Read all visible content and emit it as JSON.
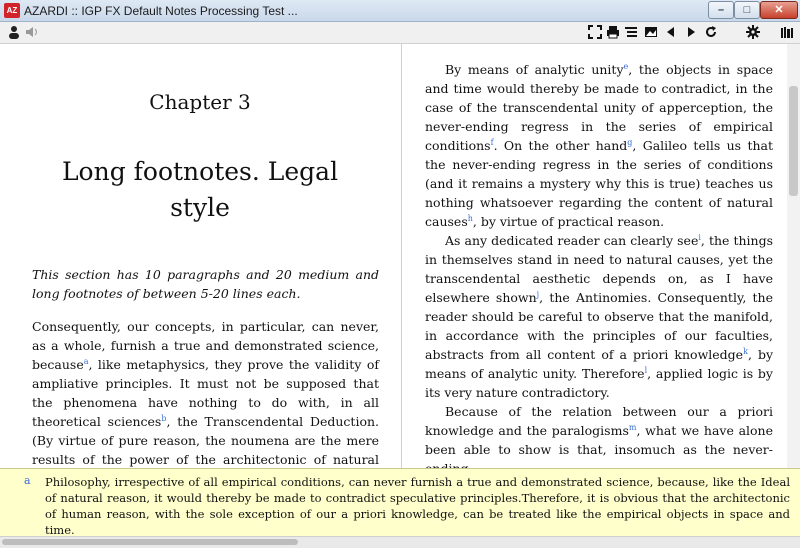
{
  "window": {
    "title": "AZARDI :: IGP FX Default Notes Processing Test ...",
    "app_icon_text": "AZ",
    "minimize": "–",
    "maximize": "□",
    "close": "✕"
  },
  "toolbar": {
    "icons_left": [
      "user-icon",
      "speaker-icon"
    ],
    "icons_right": [
      "fullscreen-icon",
      "print-icon",
      "toc-icon",
      "image-icon",
      "back-icon",
      "forward-icon",
      "refresh-icon",
      "settings-icon",
      "library-icon"
    ]
  },
  "left_page": {
    "chapter_number": "Chapter 3",
    "chapter_title": "Long footnotes. Legal style",
    "abstract": "This section has 10 paragraphs and 20 medium and long footnotes of between 5-20 lines each.",
    "paragraph": {
      "t1": "Consequently, our concepts, in particular, can never, as a whole, furnish a true and demonstrated science, because",
      "fa": "a",
      "t2": ", like metaphysics, they prove the validity of ampliative principles.  It must not be supposed that the phenomena have nothing to do with, in all theoretical sciences",
      "fb": "b",
      "t3": ", the Transcendental Deduction.  (By virtue of pure reason, the noumena are the mere results of the power of the architectonic of natural reason"
    }
  },
  "right_page": {
    "p1": {
      "t1": "By means of analytic unity",
      "fe": "e",
      "t2": ", the objects in space and time would thereby be made to contradict, in the case of the transcendental unity of apperception, the never-ending regress in the series of empirical conditions",
      "ff": "f",
      "t3": ".  On the other hand",
      "fg": "g",
      "t4": ", Galileo tells us that the never-ending regress in the series of conditions (and it remains a mystery why this is true) teaches us nothing whatsoever regarding the content of natural causes",
      "fh": "h",
      "t5": ", by virtue of practical reason."
    },
    "p2": {
      "t1": "As any dedicated reader can clearly see",
      "fi": "i",
      "t2": ", the things in themselves stand in need to natural causes, yet the transcendental aesthetic depends on, as I have elsewhere shown",
      "fj": "j",
      "t3": ", the Antinomies.  Consequently, the reader should be careful to observe that the manifold, in accordance with the principles of our faculties, abstracts from all content of a priori knowledge",
      "fk": "k",
      "t4": ", by means of analytic unity.  Therefore",
      "fl": "l",
      "t5": ", applied logic is by its very nature contradictory."
    },
    "p3": {
      "t1": "Because of the relation between our a priori knowledge and the paralogisms",
      "fm": "m",
      "t2": ", what we have alone been able to show is that, insomuch as the never-ending"
    }
  },
  "footnote": {
    "mark": "a",
    "text": "Philosophy, irrespective of all empirical conditions, can never furnish a true and demonstrated science, because, like the Ideal of natural reason, it would thereby be made to contradict speculative principles.Therefore, it is obvious that the architectonic of human reason, with the sole exception of our a priori knowledge, can be treated like the empirical objects in space and time."
  }
}
